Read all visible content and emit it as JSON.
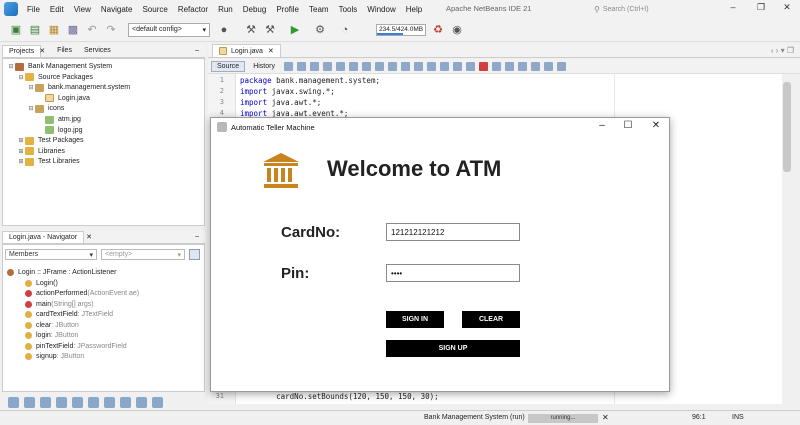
{
  "menubar": {
    "items": [
      "File",
      "Edit",
      "View",
      "Navigate",
      "Source",
      "Refactor",
      "Run",
      "Debug",
      "Profile",
      "Team",
      "Tools",
      "Window",
      "Help"
    ],
    "window_title": "Apache NetBeans IDE 21",
    "search_placeholder": "Search (Ctrl+I)"
  },
  "toolbar": {
    "config": "<default config>",
    "memory": "234.5/424.0MB",
    "memory_fraction": 0.55
  },
  "projects_panel": {
    "tabs": [
      "Projects",
      "Files",
      "Services"
    ],
    "tree": [
      {
        "label": "Bank Management System",
        "kind": "proj",
        "indent": 0
      },
      {
        "label": "Source Packages",
        "kind": "fold",
        "indent": 1
      },
      {
        "label": "bank.management.system",
        "kind": "pkg",
        "indent": 2
      },
      {
        "label": "Login.java",
        "kind": "jfile",
        "indent": 3
      },
      {
        "label": "icons",
        "kind": "pkg",
        "indent": 2
      },
      {
        "label": "atm.jpg",
        "kind": "img",
        "indent": 3
      },
      {
        "label": "logo.jpg",
        "kind": "img",
        "indent": 3
      },
      {
        "label": "Test Packages",
        "kind": "fold",
        "indent": 1
      },
      {
        "label": "Libraries",
        "kind": "fold",
        "indent": 1
      },
      {
        "label": "Test Libraries",
        "kind": "fold",
        "indent": 1
      }
    ]
  },
  "navigator": {
    "title": "Login.java - Navigator",
    "filter": "Members",
    "empty": "<empty>",
    "items": [
      {
        "name": "Login :: JFrame : ActionListener",
        "extra": "",
        "color": "#b56b3a",
        "indent": 0
      },
      {
        "name": "Login()",
        "extra": "",
        "color": "#e0b040",
        "indent": 1
      },
      {
        "name": "actionPerformed",
        "extra": "(ActionEvent ae)",
        "color": "#d04040",
        "indent": 1
      },
      {
        "name": "main",
        "extra": "(String[] args)",
        "color": "#d04040",
        "indent": 1
      },
      {
        "name": "cardTextField",
        "extra": " : JTextField",
        "color": "#e0b040",
        "indent": 1
      },
      {
        "name": "clear",
        "extra": " : JButton",
        "color": "#e0b040",
        "indent": 1
      },
      {
        "name": "login",
        "extra": " : JButton",
        "color": "#e0b040",
        "indent": 1
      },
      {
        "name": "pinTextField",
        "extra": " : JPasswordField",
        "color": "#e0b040",
        "indent": 1
      },
      {
        "name": "signup",
        "extra": " : JButton",
        "color": "#e0b040",
        "indent": 1
      }
    ]
  },
  "editor": {
    "tab": "Login.java",
    "source_label": "Source",
    "history_label": "History",
    "lines": [
      {
        "num": "1",
        "kw": "package",
        "rest": " bank.management.system;"
      },
      {
        "num": "2",
        "kw": "import",
        "rest": " javax.swing.*;"
      },
      {
        "num": "3",
        "kw": "import",
        "rest": " java.awt.*;"
      },
      {
        "num": "4",
        "kw": "import",
        "rest": " java.awt.event.*;"
      }
    ],
    "bottom_line": {
      "num": "31",
      "text": "        cardNo.setBounds(120, 150, 150, 30);"
    }
  },
  "status": {
    "run": "Bank Management System (run)",
    "progress": "running...",
    "position": "96:1",
    "mode": "INS"
  },
  "atm": {
    "title": "Automatic Teller Machine",
    "welcome": "Welcome to ATM",
    "card_label": "CardNo:",
    "card_value": "121212121212",
    "pin_label": "Pin:",
    "pin_value": "••••",
    "signin": "SIGN IN",
    "clear": "CLEAR",
    "signup": "SIGN UP",
    "icon_color": "#c8841f"
  }
}
